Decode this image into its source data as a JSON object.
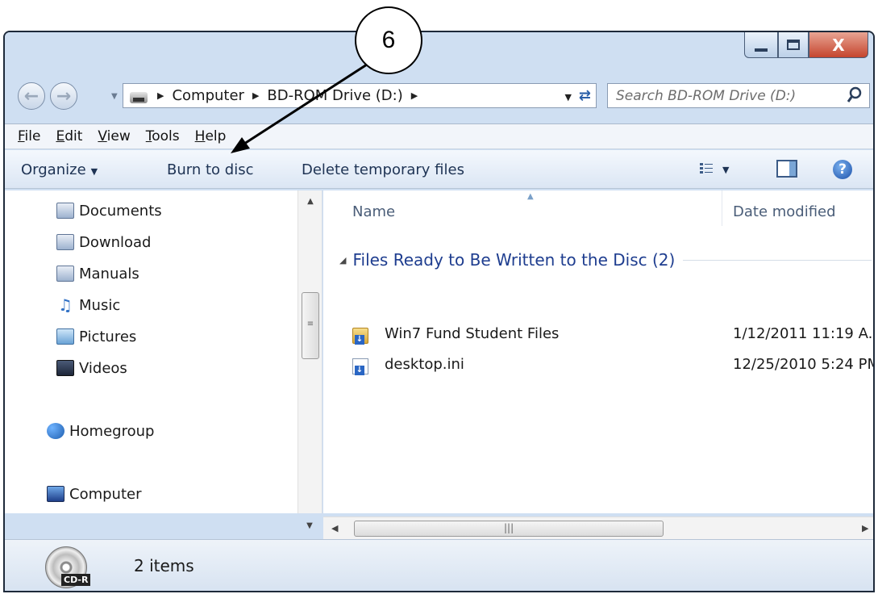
{
  "window": {
    "title_buttons": [
      "minimize",
      "maximize",
      "close"
    ],
    "close_label": "X"
  },
  "nav": {
    "address_crumbs": [
      "Computer",
      "BD-ROM Drive (D:)"
    ],
    "search_placeholder": "Search BD-ROM Drive (D:)"
  },
  "menu": {
    "items": [
      "File",
      "Edit",
      "View",
      "Tools",
      "Help"
    ]
  },
  "toolbar": {
    "organize": "Organize",
    "burn": "Burn to disc",
    "delete_temp": "Delete temporary files"
  },
  "sidebar": {
    "items": [
      {
        "label": "Documents",
        "icon": "documents-icon"
      },
      {
        "label": "Download",
        "icon": "download-library-icon"
      },
      {
        "label": "Manuals",
        "icon": "manuals-library-icon"
      },
      {
        "label": "Music",
        "icon": "music-icon"
      },
      {
        "label": "Pictures",
        "icon": "pictures-icon"
      },
      {
        "label": "Videos",
        "icon": "videos-icon"
      },
      {
        "label": "Homegroup",
        "icon": "homegroup-icon"
      },
      {
        "label": "Computer",
        "icon": "computer-icon"
      }
    ]
  },
  "content": {
    "columns": {
      "name": "Name",
      "date": "Date modified"
    },
    "group_title": "Files Ready to Be Written to the Disc (2)",
    "files": [
      {
        "name": "Win7 Fund Student Files",
        "date": "1/12/2011 11:19 A..",
        "type": "folder"
      },
      {
        "name": "desktop.ini",
        "date": "12/25/2010 5:24 PM",
        "type": "file"
      }
    ]
  },
  "details": {
    "count": "2 items",
    "disc_label": "CD-R"
  },
  "callout": {
    "number": "6"
  },
  "colors": {
    "group_header": "#1e3d8f",
    "toolbar_text": "#1e3354",
    "close_button": "#c5452e"
  }
}
